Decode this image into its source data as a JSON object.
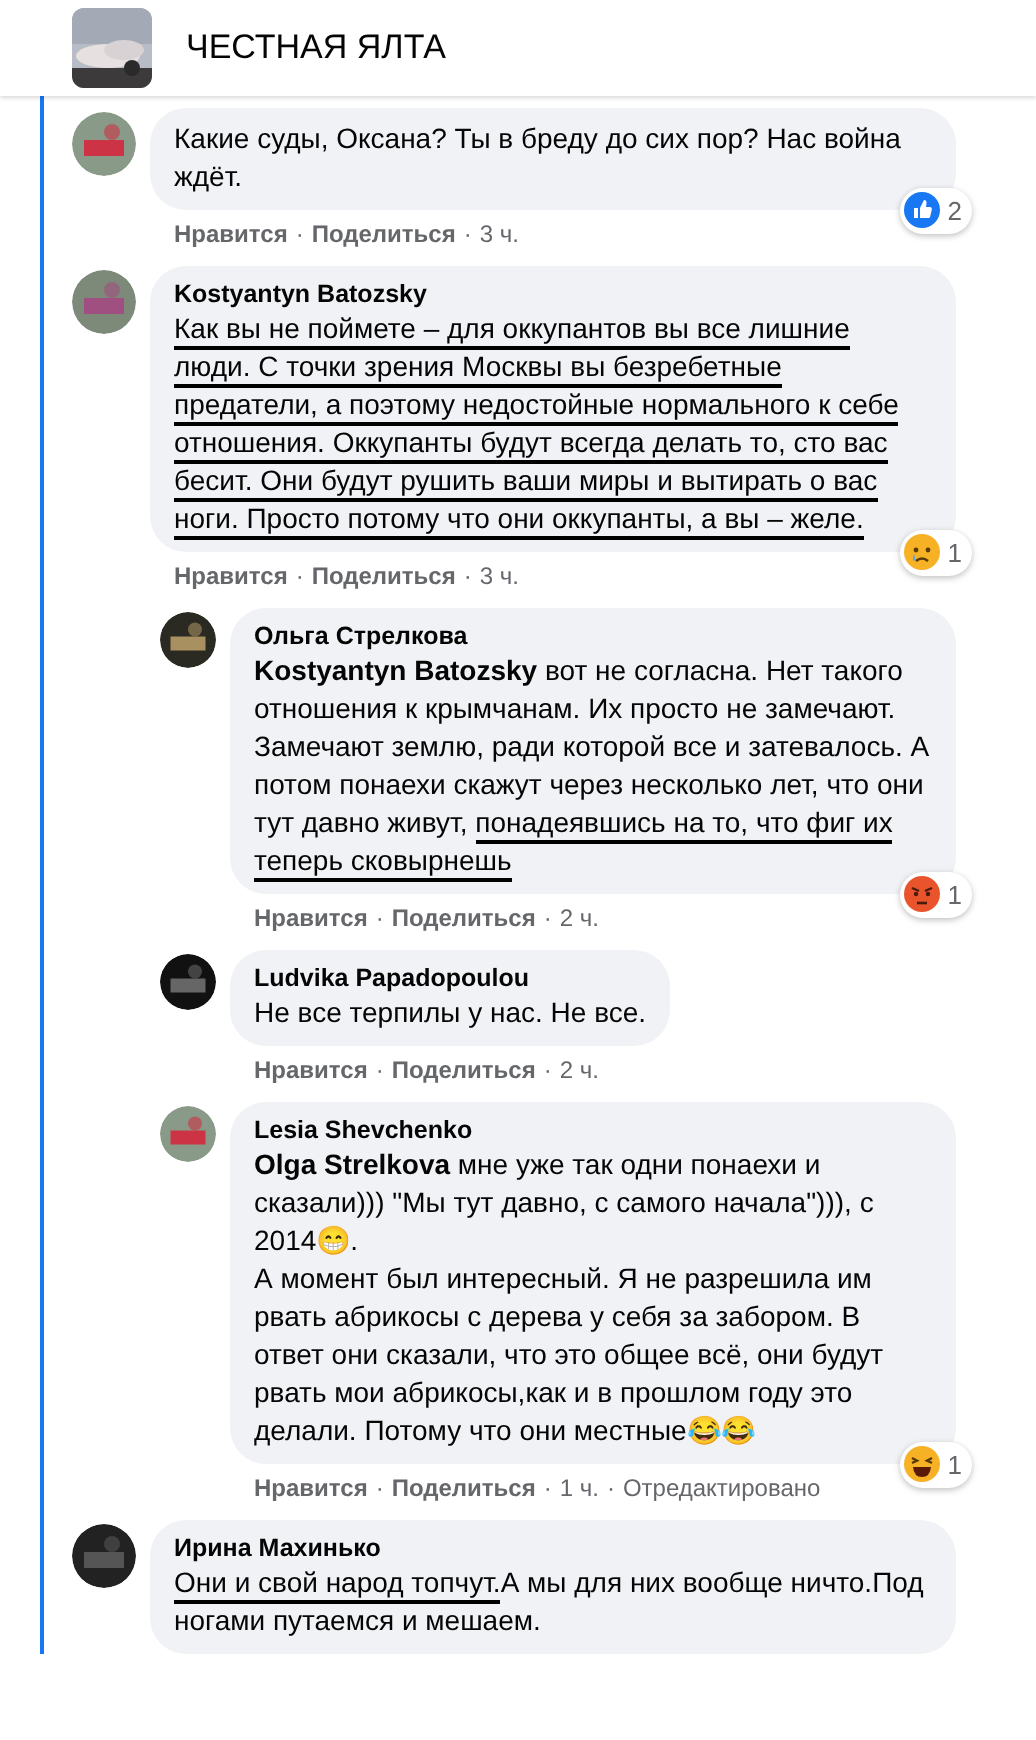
{
  "header": {
    "title": "ЧЕСТНАЯ ЯЛТА"
  },
  "comments": [
    {
      "body": [
        {
          "text": "Какие суды, Оксана? Ты в бреду до сих пор? Нас война ждёт.",
          "marked": false
        }
      ],
      "actions": [
        {
          "kind": "link",
          "text": "Нравится"
        },
        {
          "kind": "dot",
          "text": "·"
        },
        {
          "kind": "link",
          "text": "Поделиться"
        },
        {
          "kind": "dot",
          "text": "·"
        },
        {
          "kind": "time",
          "text": "3 ч."
        }
      ],
      "reaction": {
        "kind": "like",
        "count": "2"
      }
    },
    {
      "author": "Kostyantyn Batozsky",
      "body": [
        {
          "text": "Как вы не поймете – для оккупантов вы все лишние люди. С точки зрения Москвы вы безребетные предатели, а поэтому недостойные нормального к себе отношения. Оккупанты будут всегда делать то, сто вас бесит. Они будут рушить ваши миры и вытирать о вас ноги. Просто потому что они оккупанты, а вы – желе.",
          "marked": true
        }
      ],
      "actions": [
        {
          "kind": "link",
          "text": "Нравится"
        },
        {
          "kind": "dot",
          "text": "·"
        },
        {
          "kind": "link",
          "text": "Поделиться"
        },
        {
          "kind": "dot",
          "text": "·"
        },
        {
          "kind": "time",
          "text": "3 ч."
        }
      ],
      "reaction": {
        "kind": "sad",
        "count": "1"
      },
      "children": [
        {
          "author": "Ольга Стрелкова",
          "body": [
            {
              "text": "**Kostyantyn Batozsky** вот не согласна. Нет такого отношения к крымчанам. Их просто не замечают. Замечают землю, ради которой все и затевалось. А потом понаехи скажут через несколько лет, что они тут давно живут, ",
              "marked": false
            },
            {
              "text": "понадеявшись на то, что фиг их теперь сковырнешь",
              "marked": true
            }
          ],
          "actions": [
            {
              "kind": "link",
              "text": "Нравится"
            },
            {
              "kind": "dot",
              "text": "·"
            },
            {
              "kind": "link",
              "text": "Поделиться"
            },
            {
              "kind": "dot",
              "text": "·"
            },
            {
              "kind": "time",
              "text": "2 ч."
            }
          ],
          "reaction": {
            "kind": "angry",
            "count": "1"
          }
        },
        {
          "author": "Ludvika Papadopoulou",
          "body": [
            {
              "text": "Не все терпилы у нас. Не все.",
              "marked": false
            }
          ],
          "actions": [
            {
              "kind": "link",
              "text": "Нравится"
            },
            {
              "kind": "dot",
              "text": "·"
            },
            {
              "kind": "link",
              "text": "Поделиться"
            },
            {
              "kind": "dot",
              "text": "·"
            },
            {
              "kind": "time",
              "text": "2 ч."
            }
          ]
        },
        {
          "author": "Lesia Shevchenko",
          "body": [
            {
              "text": "**Olga Strelkova** мне уже так одни понаехи и сказали))) \"Мы тут давно, с самого начала\"))), с 2014😁.\nА момент был интересный. Я не разрешила им рвать абрикосы с дерева у себя за забором. В ответ они сказали, что это общее всё, они будут рвать мои абрикосы,как и в прошлом году это делали. Потому что они местные😂😂",
              "marked": false
            }
          ],
          "actions": [
            {
              "kind": "link",
              "text": "Нравится"
            },
            {
              "kind": "dot",
              "text": "·"
            },
            {
              "kind": "link",
              "text": "Поделиться"
            },
            {
              "kind": "dot",
              "text": "·"
            },
            {
              "kind": "time",
              "text": "1 ч."
            },
            {
              "kind": "dot",
              "text": "·"
            },
            {
              "kind": "note",
              "text": "Отредактировано"
            }
          ],
          "reaction": {
            "kind": "haha",
            "count": "1"
          }
        }
      ]
    },
    {
      "author": "Ирина Махинько",
      "body": [
        {
          "text": "Они и свой народ топчут.",
          "marked": true
        },
        {
          "text": "А мы для них вообще ничто.Под ногами путаемся и мешаем.",
          "marked": false
        }
      ]
    }
  ]
}
